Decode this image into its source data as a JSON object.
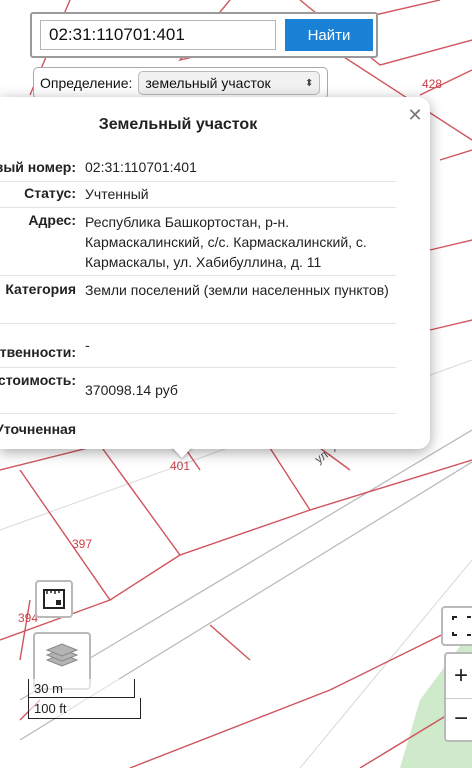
{
  "search": {
    "value": "02:31:110701:401",
    "button_label": "Найти"
  },
  "definition": {
    "label": "Определение:",
    "selected": "земельный участок"
  },
  "popup": {
    "title": "Земельный участок",
    "rows": [
      {
        "key": "Кадастровый номер:",
        "value": "02:31:110701:401"
      },
      {
        "key": "Статус:",
        "value": "Учтенный"
      },
      {
        "key": "Адрес:",
        "value": "Республика Башкортостан, р-н. Кармаскалинский, с/с. Кармаскалинский, с. Кармаскалы, ул. Хабибуллина, д. 11"
      },
      {
        "key": "Категория",
        "value": "Земли поселений (земли населенных пунктов)"
      },
      {
        "key": "Форма собственности:",
        "value": "-"
      },
      {
        "key": "Кадастровая стоимость:",
        "value": "370098.14 руб"
      },
      {
        "key": "Уточненная",
        "value": ""
      }
    ]
  },
  "map": {
    "parcel_labels": [
      "428",
      "401",
      "397",
      "394"
    ],
    "street_label": "ул. Х",
    "scale": {
      "metric": "30 m",
      "imperial": "100 ft"
    }
  },
  "colors": {
    "button": "#1a82d6",
    "boundary": "#d0545e",
    "green_area": "#cfeacb"
  }
}
